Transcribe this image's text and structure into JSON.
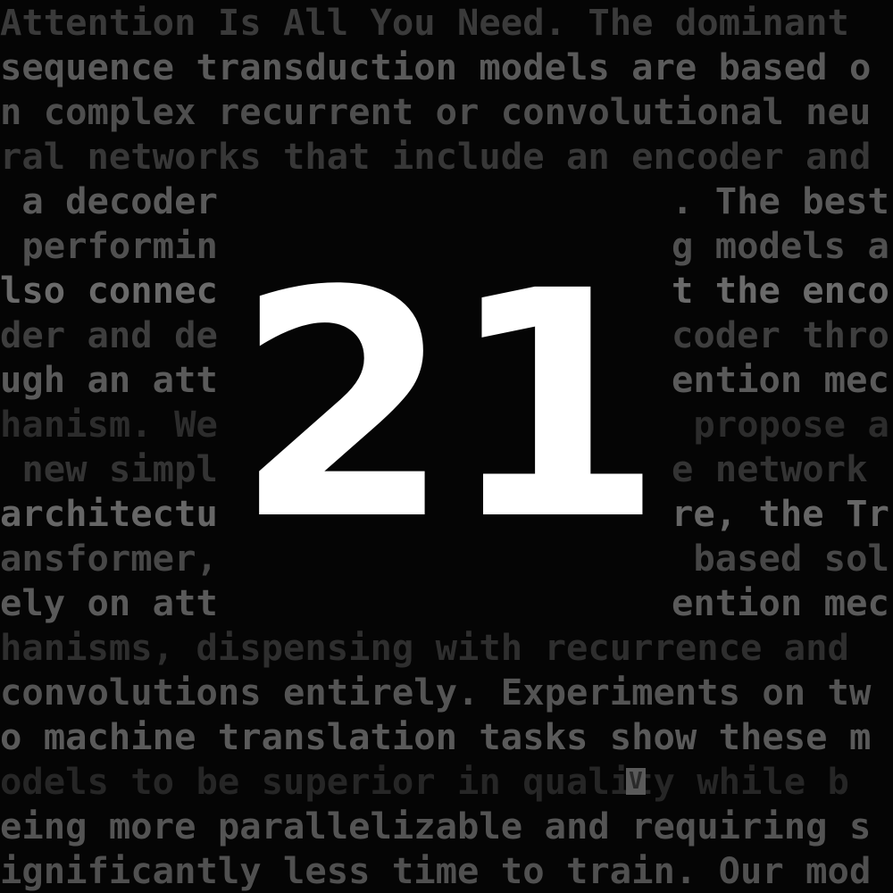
{
  "text_lines": {
    "l1": "Attention Is All You Need. The dominant ",
    "l2": "sequence transduction models are based o",
    "l3": "n complex recurrent or convolutional neu",
    "l4": "ral networks that include an encoder and",
    "l5a": " a decoder",
    "l5b": ". The best",
    "l6a": " performin",
    "l6b": "g models a",
    "l7a": "lso connec",
    "l7b": "t the enco",
    "l8a": "der and de",
    "l8b": "coder thro",
    "l9a": "ugh an att",
    "l9b": "ention mec",
    "l10a": "hanism. We",
    "l10b": " propose a",
    "l11a": " new simpl",
    "l11b": "e network ",
    "l12a": "architectu",
    "l12b": "re, the Tr",
    "l13a": "ansformer,",
    "l13b": " based sol",
    "l14a": "ely on att",
    "l14b": "ention mec",
    "l15": "hanisms, dispensing with recurrence and ",
    "l16": "convolutions entirely. Experiments on tw",
    "l17": "o machine translation tasks show these m",
    "l18": "odels to be superior in quality while b",
    "l19": "eing more parallelizable and requiring s",
    "l20": "ignificantly less time to train. Our mod"
  },
  "big_number": "21",
  "highlight_char": "V",
  "colors": {
    "background": "#050505",
    "big_number": "#ffffff",
    "cursor_box": "#5a5a5a"
  }
}
